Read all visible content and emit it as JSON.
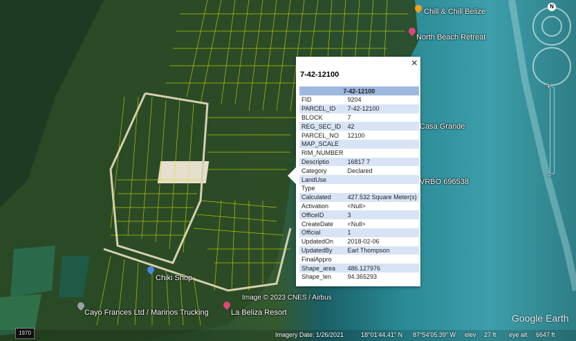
{
  "map": {
    "labels": {
      "chill": "Chill & Chill Belize",
      "north_beach": "North Beach Retreat",
      "casa_grande": "Casa Grande",
      "vrbo": "VRBO 696538",
      "chiki": "Chiki Shop",
      "cayo": "Cayo Frances Ltd / Marinos Trucking",
      "beliza": "La Beliza Resort",
      "image_credit": "Image © 2023 CNES / Airbus"
    },
    "compass_n": "N",
    "year": "1970",
    "logo": "Google Earth"
  },
  "popup": {
    "title": "7-42-12100",
    "close": "×",
    "table_header": "7-42-12100",
    "rows": [
      {
        "k": "FID",
        "v": "9204"
      },
      {
        "k": "PARCEL_ID",
        "v": "7-42-12100"
      },
      {
        "k": "BLOCK",
        "v": "7"
      },
      {
        "k": "REG_SEC_ID",
        "v": "42"
      },
      {
        "k": "PARCEL_NO",
        "v": "12100"
      },
      {
        "k": "MAP_SCALE",
        "v": ""
      },
      {
        "k": "RIM_NUMBER",
        "v": ""
      },
      {
        "k": "Descriptio",
        "v": "16817 7"
      },
      {
        "k": "Category",
        "v": "Declared"
      },
      {
        "k": "LandUse",
        "v": ""
      },
      {
        "k": "Type",
        "v": ""
      },
      {
        "k": "Calculated",
        "v": "427.532 Square Meter(s)"
      },
      {
        "k": "Activation",
        "v": "<Null>"
      },
      {
        "k": "OfficeID",
        "v": "3"
      },
      {
        "k": "CreateDate",
        "v": "<Null>"
      },
      {
        "k": "Official",
        "v": "1"
      },
      {
        "k": "UpdatedOn",
        "v": "2018-02-06"
      },
      {
        "k": "UpdatedBy",
        "v": "Earl Thompson"
      },
      {
        "k": "FinalAppro",
        "v": ""
      },
      {
        "k": "Shape_area",
        "v": "486.127976"
      },
      {
        "k": "Shape_len",
        "v": "94.365293"
      }
    ]
  },
  "status": {
    "imagery_date": "Imagery Date: 1/26/2021",
    "lat": "18°01'44.41\" N",
    "lon": "87°54'05.39\" W",
    "elev_label": "elev",
    "elev": "27 ft",
    "eye_alt_label": "eye alt",
    "eye_alt": "6647 ft"
  }
}
